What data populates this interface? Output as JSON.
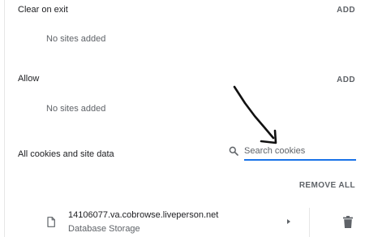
{
  "clear_on_exit": {
    "title": "Clear on exit",
    "add_label": "ADD",
    "empty_text": "No sites added"
  },
  "allow": {
    "title": "Allow",
    "add_label": "ADD",
    "empty_text": "No sites added"
  },
  "all_cookies": {
    "title": "All cookies and site data",
    "search_placeholder": "Search cookies",
    "remove_all_label": "REMOVE ALL"
  },
  "sites": [
    {
      "name": "14106077.va.cobrowse.liveperson.net",
      "subtitle": "Database Storage",
      "icon": "file-icon"
    }
  ],
  "colors": {
    "accent": "#1a73e8",
    "muted_text": "#5f6368"
  },
  "icons": {
    "search": "search-icon",
    "expand": "chevron-right-icon",
    "delete": "trash-icon"
  }
}
